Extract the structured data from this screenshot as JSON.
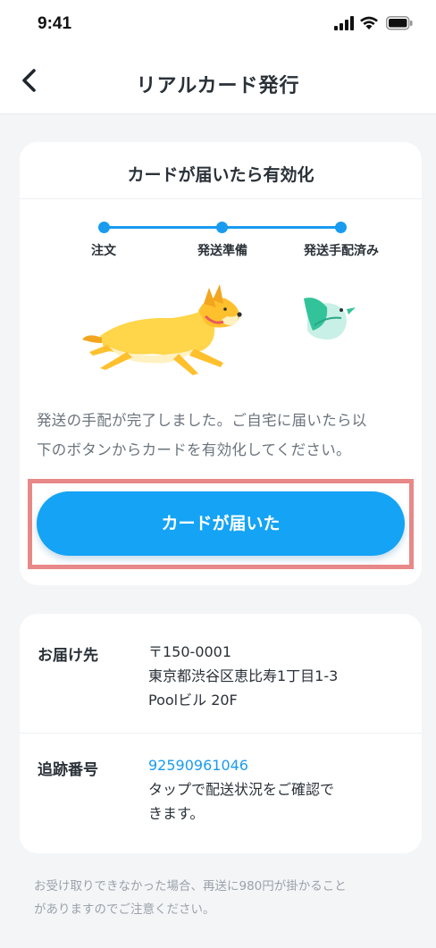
{
  "status_bar": {
    "time": "9:41",
    "icons": [
      "cellular-signal-icon",
      "wifi-icon",
      "battery-icon"
    ]
  },
  "nav": {
    "title": "リアルカード発行",
    "back_icon": "chevron-left-icon"
  },
  "activation_card": {
    "title": "カードが届いたら有効化",
    "steps": [
      {
        "label": "注文"
      },
      {
        "label": "発送準備"
      },
      {
        "label": "発送手配済み"
      }
    ],
    "illustration_icons": [
      "running-dog-icon",
      "bird-icon"
    ],
    "message_line1": "発送の手配が完了しました。ご自宅に届いたら以",
    "message_line2": "下のボタンからカードを有効化してください。",
    "button_label": "カードが届いた"
  },
  "info_card": {
    "address_label": "お届け先",
    "address_line1": "〒150-0001",
    "address_line2": "東京都渋谷区恵比寿1丁目1-3",
    "address_line3": "Poolビル 20F",
    "tracking_label": "追跡番号",
    "tracking_number": "92590961046",
    "tracking_note_line1": "タップで配送状況をご確認で",
    "tracking_note_line2": "きます。"
  },
  "footer": {
    "note_line1": "お受け取りできなかった場合、再送に980円が掛かること",
    "note_line2": "がありますのでご注意ください。"
  },
  "colors": {
    "accent": "#14A3F5",
    "highlight": "#E88888",
    "background": "#F4F5F7"
  }
}
